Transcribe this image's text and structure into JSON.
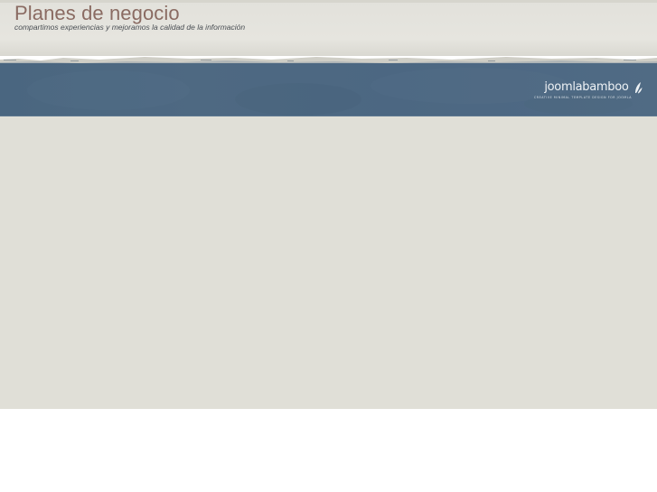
{
  "header": {
    "title": "Planes de negocio",
    "tagline": "compartimos experiencias y mejoramos la calidad de la información"
  },
  "banner": {
    "logo_text": "joomlabamboo",
    "logo_subtitle": "creative minimal template design for joomla"
  },
  "colors": {
    "title": "#8a6b62",
    "banner": "#4d6883",
    "content_bg": "#e0dfd7",
    "header_bg": "#e4e3dd"
  },
  "icons": {
    "logo_mark": "bamboo-leaf-icon"
  }
}
